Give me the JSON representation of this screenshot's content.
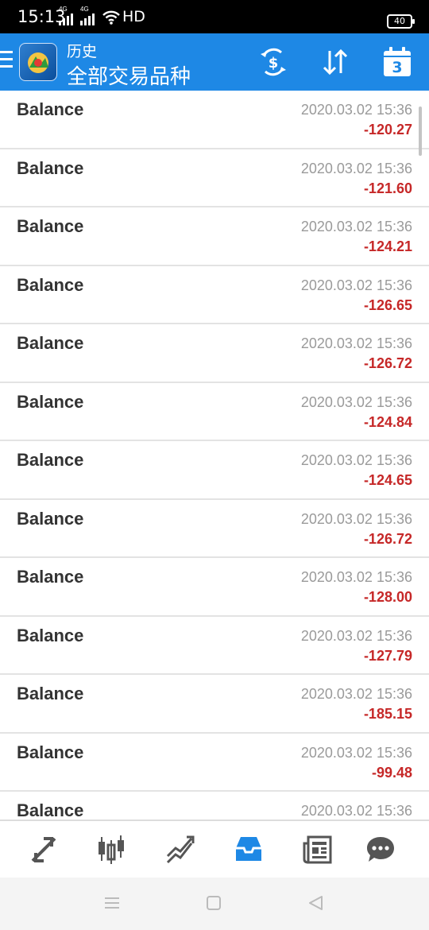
{
  "status_bar": {
    "time": "15:13",
    "signal1_label": "4G",
    "signal2_label": "4G",
    "network_label": "HD",
    "battery": "40"
  },
  "app_bar": {
    "title_small": "历史",
    "title_big": "全部交易品种",
    "calendar_day": "3",
    "color": "#1e88e5"
  },
  "history": [
    {
      "name": "Balance",
      "date": "2020.03.02 15:36",
      "amount": "-120.27"
    },
    {
      "name": "Balance",
      "date": "2020.03.02 15:36",
      "amount": "-121.60"
    },
    {
      "name": "Balance",
      "date": "2020.03.02 15:36",
      "amount": "-124.21"
    },
    {
      "name": "Balance",
      "date": "2020.03.02 15:36",
      "amount": "-126.65"
    },
    {
      "name": "Balance",
      "date": "2020.03.02 15:36",
      "amount": "-126.72"
    },
    {
      "name": "Balance",
      "date": "2020.03.02 15:36",
      "amount": "-124.84"
    },
    {
      "name": "Balance",
      "date": "2020.03.02 15:36",
      "amount": "-124.65"
    },
    {
      "name": "Balance",
      "date": "2020.03.02 15:36",
      "amount": "-126.72"
    },
    {
      "name": "Balance",
      "date": "2020.03.02 15:36",
      "amount": "-128.00"
    },
    {
      "name": "Balance",
      "date": "2020.03.02 15:36",
      "amount": "-127.79"
    },
    {
      "name": "Balance",
      "date": "2020.03.02 15:36",
      "amount": "-185.15"
    },
    {
      "name": "Balance",
      "date": "2020.03.02 15:36",
      "amount": "-99.48"
    },
    {
      "name": "Balance",
      "date": "2020.03.02 15:36",
      "amount": ""
    }
  ],
  "bottom_nav": {
    "items": [
      "quotes-icon",
      "chart-icon",
      "trade-icon",
      "history-icon",
      "news-icon",
      "chat-icon"
    ],
    "active": "history-icon",
    "active_color": "#1e88e5",
    "inactive_color": "#555555"
  },
  "colors": {
    "negative_amount": "#c62828"
  }
}
